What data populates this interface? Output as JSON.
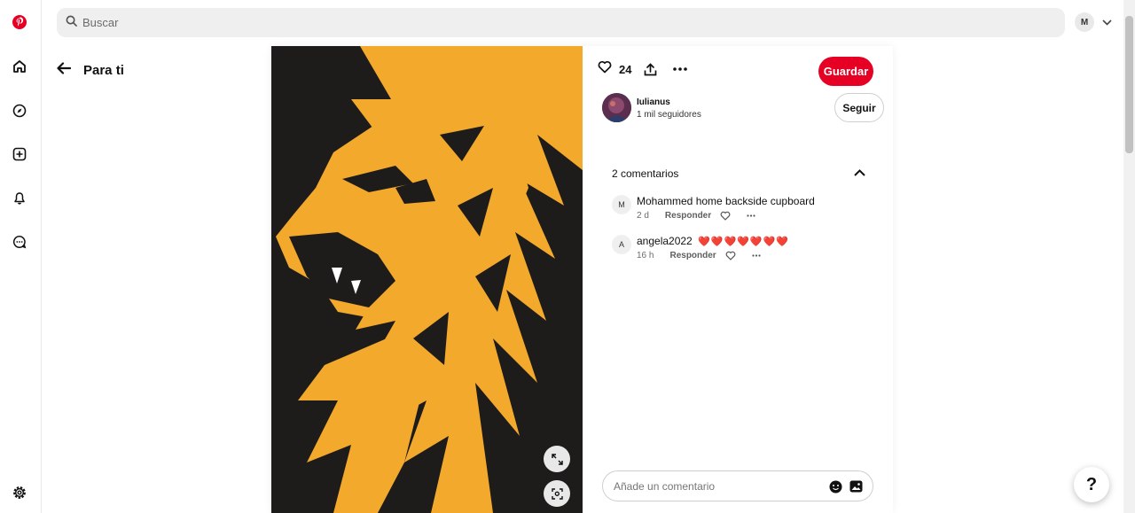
{
  "topbar": {
    "search_placeholder": "Buscar",
    "user_initial": "M"
  },
  "nav": {
    "back_label": "Para ti"
  },
  "pin": {
    "like_count": "24",
    "save_label": "Guardar",
    "creator": {
      "name": "Iulianus",
      "followers": "1   mil seguidores"
    },
    "follow_label": "Seguir"
  },
  "comments": {
    "title": "2 comentarios",
    "items": [
      {
        "initial": "M",
        "author": "Mohammed",
        "text": "home backside cupboard",
        "time": "2 d",
        "reply": "Responder"
      },
      {
        "initial": "A",
        "author": "angela2022",
        "text": "❤️❤️❤️❤️❤️❤️❤️",
        "time": "16 h",
        "reply": "Responder"
      }
    ],
    "input_placeholder": "Añade un comentario"
  },
  "help": {
    "label": "?"
  },
  "colors": {
    "brand": "#e60023",
    "lion": "#f2a92c",
    "image_bg": "#1e1b1b"
  }
}
